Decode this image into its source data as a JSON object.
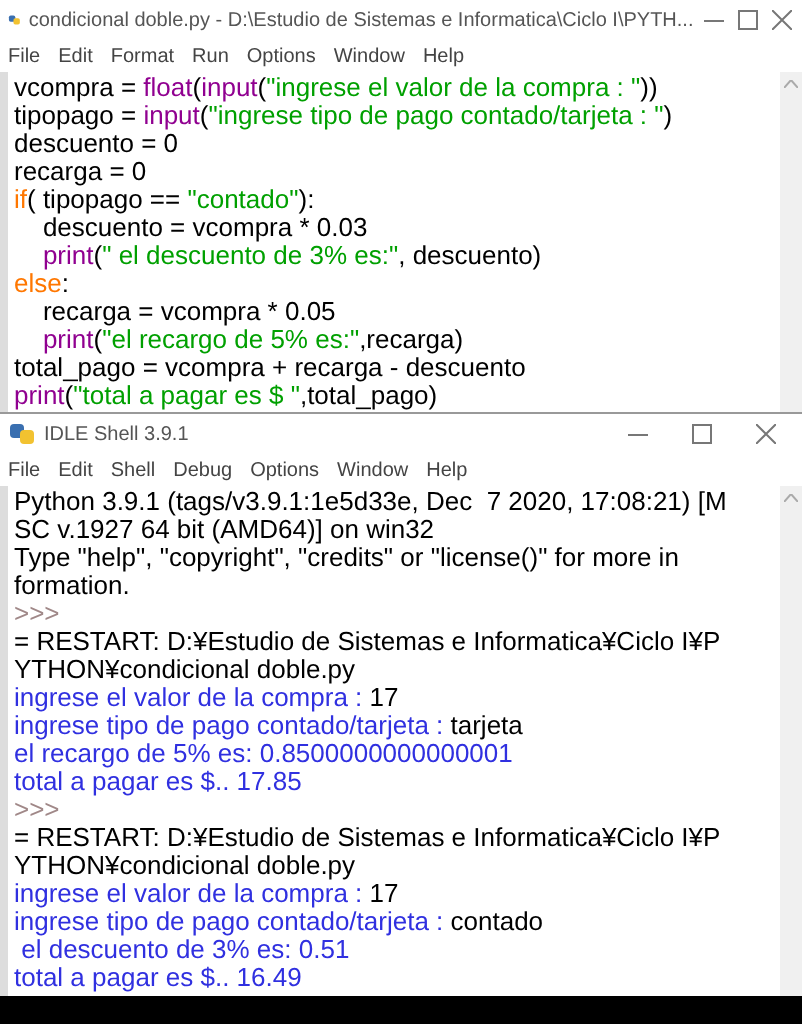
{
  "editor": {
    "title": "condicional doble.py - D:\\Estudio de Sistemas e Informatica\\Ciclo I\\PYTH...",
    "menu": [
      "File",
      "Edit",
      "Format",
      "Run",
      "Options",
      "Window",
      "Help"
    ],
    "lines": [
      [
        {
          "kind": "plain",
          "text": "vcompra = "
        },
        {
          "kind": "builtin",
          "text": "float"
        },
        {
          "kind": "plain",
          "text": "("
        },
        {
          "kind": "builtin",
          "text": "input"
        },
        {
          "kind": "plain",
          "text": "("
        },
        {
          "kind": "string",
          "text": "\"ingrese el valor de la compra : \""
        },
        {
          "kind": "plain",
          "text": "))"
        }
      ],
      [
        {
          "kind": "plain",
          "text": "tipopago = "
        },
        {
          "kind": "builtin",
          "text": "input"
        },
        {
          "kind": "plain",
          "text": "("
        },
        {
          "kind": "string",
          "text": "\"ingrese tipo de pago contado/tarjeta : \""
        },
        {
          "kind": "plain",
          "text": ")"
        }
      ],
      [
        {
          "kind": "plain",
          "text": "descuento = 0"
        }
      ],
      [
        {
          "kind": "plain",
          "text": "recarga = 0"
        }
      ],
      [
        {
          "kind": "keyword",
          "text": "if"
        },
        {
          "kind": "plain",
          "text": "( tipopago == "
        },
        {
          "kind": "string",
          "text": "\"contado\""
        },
        {
          "kind": "plain",
          "text": "):"
        }
      ],
      [
        {
          "kind": "plain",
          "text": "    descuento = vcompra * 0.03"
        }
      ],
      [
        {
          "kind": "builtin",
          "text": "    print"
        },
        {
          "kind": "plain",
          "text": "("
        },
        {
          "kind": "string",
          "text": "\" el descuento de 3% es:\""
        },
        {
          "kind": "plain",
          "text": ", descuento)"
        }
      ],
      [
        {
          "kind": "keyword",
          "text": "else"
        },
        {
          "kind": "plain",
          "text": ":"
        }
      ],
      [
        {
          "kind": "plain",
          "text": "    recarga = vcompra * 0.05"
        }
      ],
      [
        {
          "kind": "builtin",
          "text": "    print"
        },
        {
          "kind": "plain",
          "text": "("
        },
        {
          "kind": "string",
          "text": "\"el recargo de 5% es:\""
        },
        {
          "kind": "plain",
          "text": ",recarga)"
        }
      ],
      [
        {
          "kind": "plain",
          "text": "total_pago = vcompra + recarga - descuento"
        }
      ],
      [
        {
          "kind": "builtin",
          "text": "print"
        },
        {
          "kind": "plain",
          "text": "("
        },
        {
          "kind": "string",
          "text": "\"total a pagar es $ \""
        },
        {
          "kind": "plain",
          "text": ",total_pago)"
        }
      ]
    ]
  },
  "shell": {
    "title": "IDLE Shell 3.9.1",
    "menu": [
      "File",
      "Edit",
      "Shell",
      "Debug",
      "Options",
      "Window",
      "Help"
    ],
    "lines": [
      [
        {
          "kind": "plain",
          "text": "Python 3.9.1 (tags/v3.9.1:1e5d33e, Dec  7 2020, 17:08:21) [M"
        }
      ],
      [
        {
          "kind": "plain",
          "text": "SC v.1927 64 bit (AMD64)] on win32"
        }
      ],
      [
        {
          "kind": "plain",
          "text": "Type \"help\", \"copyright\", \"credits\" or \"license()\" for more in"
        }
      ],
      [
        {
          "kind": "plain",
          "text": "formation."
        }
      ],
      [
        {
          "kind": "prompt",
          "text": ">>>"
        }
      ],
      [
        {
          "kind": "plain",
          "text": "= RESTART: D:¥Estudio de Sistemas e Informatica¥Ciclo I¥P"
        }
      ],
      [
        {
          "kind": "plain",
          "text": "YTHON¥condicional doble.py"
        }
      ],
      [
        {
          "kind": "stdout",
          "text": "ingrese el valor de la compra : "
        },
        {
          "kind": "plain",
          "text": "17"
        }
      ],
      [
        {
          "kind": "stdout",
          "text": "ingrese tipo de pago contado/tarjeta : "
        },
        {
          "kind": "plain",
          "text": "tarjeta"
        }
      ],
      [
        {
          "kind": "stdout",
          "text": "el recargo de 5% es: 0.8500000000000001"
        }
      ],
      [
        {
          "kind": "stdout",
          "text": "total a pagar es $.. 17.85"
        }
      ],
      [
        {
          "kind": "prompt",
          "text": ">>>"
        }
      ],
      [
        {
          "kind": "plain",
          "text": "= RESTART: D:¥Estudio de Sistemas e Informatica¥Ciclo I¥P"
        }
      ],
      [
        {
          "kind": "plain",
          "text": "YTHON¥condicional doble.py"
        }
      ],
      [
        {
          "kind": "stdout",
          "text": "ingrese el valor de la compra : "
        },
        {
          "kind": "plain",
          "text": "17"
        }
      ],
      [
        {
          "kind": "stdout",
          "text": "ingrese tipo de pago contado/tarjeta : "
        },
        {
          "kind": "plain",
          "text": "contado"
        }
      ],
      [
        {
          "kind": "stdout",
          "text": " el descuento de 3% es: 0.51"
        }
      ],
      [
        {
          "kind": "stdout",
          "text": "total a pagar es $.. 16.49"
        }
      ]
    ]
  }
}
